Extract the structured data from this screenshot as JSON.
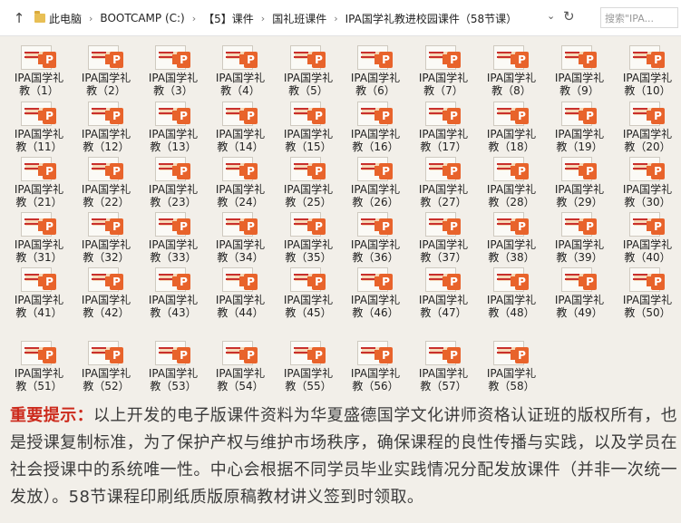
{
  "address_bar": {
    "crumbs": [
      "此电脑",
      "BOOTCAMP (C:)",
      "【5】课件",
      "国礼班课件",
      "IPA国学礼教进校园课件（58节课）"
    ],
    "search_placeholder": "搜索\"IPA..."
  },
  "files": [
    {
      "line1": "IPA国学礼",
      "line2": "教（1）"
    },
    {
      "line1": "IPA国学礼",
      "line2": "教（2）"
    },
    {
      "line1": "IPA国学礼",
      "line2": "教（3）"
    },
    {
      "line1": "IPA国学礼",
      "line2": "教（4）"
    },
    {
      "line1": "IPA国学礼",
      "line2": "教（5）"
    },
    {
      "line1": "IPA国学礼",
      "line2": "教（6）"
    },
    {
      "line1": "IPA国学礼",
      "line2": "教（7）"
    },
    {
      "line1": "IPA国学礼",
      "line2": "教（8）"
    },
    {
      "line1": "IPA国学礼",
      "line2": "教（9）"
    },
    {
      "line1": "IPA国学礼",
      "line2": "教（10）"
    },
    {
      "line1": "IPA国学礼",
      "line2": "教（11）"
    },
    {
      "line1": "IPA国学礼",
      "line2": "教（12）"
    },
    {
      "line1": "IPA国学礼",
      "line2": "教（13）"
    },
    {
      "line1": "IPA国学礼",
      "line2": "教（14）"
    },
    {
      "line1": "IPA国学礼",
      "line2": "教（15）"
    },
    {
      "line1": "IPA国学礼",
      "line2": "教（16）"
    },
    {
      "line1": "IPA国学礼",
      "line2": "教（17）"
    },
    {
      "line1": "IPA国学礼",
      "line2": "教（18）"
    },
    {
      "line1": "IPA国学礼",
      "line2": "教（19）"
    },
    {
      "line1": "IPA国学礼",
      "line2": "教（20）"
    },
    {
      "line1": "IPA国学礼",
      "line2": "教（21）"
    },
    {
      "line1": "IPA国学礼",
      "line2": "教（22）"
    },
    {
      "line1": "IPA国学礼",
      "line2": "教（23）"
    },
    {
      "line1": "IPA国学礼",
      "line2": "教（24）"
    },
    {
      "line1": "IPA国学礼",
      "line2": "教（25）"
    },
    {
      "line1": "IPA国学礼",
      "line2": "教（26）"
    },
    {
      "line1": "IPA国学礼",
      "line2": "教（27）"
    },
    {
      "line1": "IPA国学礼",
      "line2": "教（28）"
    },
    {
      "line1": "IPA国学礼",
      "line2": "教（29）"
    },
    {
      "line1": "IPA国学礼",
      "line2": "教（30）"
    },
    {
      "line1": "IPA国学礼",
      "line2": "教（31）"
    },
    {
      "line1": "IPA国学礼",
      "line2": "教（32）"
    },
    {
      "line1": "IPA国学礼",
      "line2": "教（33）"
    },
    {
      "line1": "IPA国学礼",
      "line2": "教（34）"
    },
    {
      "line1": "IPA国学礼",
      "line2": "教（35）"
    },
    {
      "line1": "IPA国学礼",
      "line2": "教（36）"
    },
    {
      "line1": "IPA国学礼",
      "line2": "教（37）"
    },
    {
      "line1": "IPA国学礼",
      "line2": "教（38）"
    },
    {
      "line1": "IPA国学礼",
      "line2": "教（39）"
    },
    {
      "line1": "IPA国学礼",
      "line2": "教（40）"
    },
    {
      "line1": "IPA国学礼",
      "line2": "教（41）"
    },
    {
      "line1": "IPA国学礼",
      "line2": "教（42）"
    },
    {
      "line1": "IPA国学礼",
      "line2": "教（43）"
    },
    {
      "line1": "IPA国学礼",
      "line2": "教（44）"
    },
    {
      "line1": "IPA国学礼",
      "line2": "教（45）"
    },
    {
      "line1": "IPA国学礼",
      "line2": "教（46）"
    },
    {
      "line1": "IPA国学礼",
      "line2": "教（47）"
    },
    {
      "line1": "IPA国学礼",
      "line2": "教（48）"
    },
    {
      "line1": "IPA国学礼",
      "line2": "教（49）"
    },
    {
      "line1": "IPA国学礼",
      "line2": "教（50）"
    },
    {
      "line1": "IPA国学礼",
      "line2": "教（51）"
    },
    {
      "line1": "IPA国学礼",
      "line2": "教（52）"
    },
    {
      "line1": "IPA国学礼",
      "line2": "教（53）"
    },
    {
      "line1": "IPA国学礼",
      "line2": "教（54）"
    },
    {
      "line1": "IPA国学礼",
      "line2": "教（55）"
    },
    {
      "line1": "IPA国学礼",
      "line2": "教（56）"
    },
    {
      "line1": "IPA国学礼",
      "line2": "教（57）"
    },
    {
      "line1": "IPA国学礼",
      "line2": "教（58）"
    }
  ],
  "file_icon": "powerpoint-icon",
  "notice": {
    "lead": "重要提示：",
    "body": "以上开发的电子版课件资料为华夏盛德国学文化讲师资格认证班的版权所有，也是授课复制标准，为了保护产权与维护市场秩序，确保课程的良性传播与实践，以及学员在社会授课中的系统唯一性。中心会根据不同学员毕业实践情况分配发放课件（并非一次统一发放）。58节课程印刷纸质版原稿教材讲义签到时领取。"
  },
  "colors": {
    "accent_red": "#cc2a1c",
    "ppt_orange": "#e8632b"
  }
}
